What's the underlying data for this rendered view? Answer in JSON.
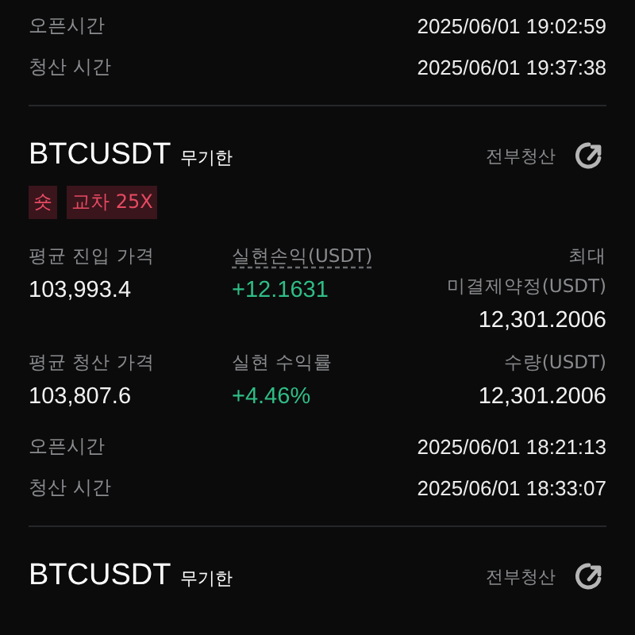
{
  "trades": [
    {
      "times": [
        {
          "label": "오픈시간",
          "value": "2025/06/01 19:02:59"
        },
        {
          "label": "청산 시간",
          "value": "2025/06/01 19:37:38"
        }
      ]
    },
    {
      "symbol": "BTCUSDT",
      "contract": "무기한",
      "action": "전부청산",
      "tags": [
        {
          "label": "숏"
        },
        {
          "label": "교차 25X"
        }
      ],
      "stats": [
        {
          "label": "평균 진입 가격",
          "value": "103,993.4",
          "kind": "plain"
        },
        {
          "label": "실현손익(USDT)",
          "value": "+12.1631",
          "kind": "profit",
          "underlined": true
        },
        {
          "label": "최대\n미결제약정(USDT)",
          "value": "12,301.2006",
          "kind": "plain"
        },
        {
          "label": "평균 청산 가격",
          "value": "103,807.6",
          "kind": "plain"
        },
        {
          "label": "실현 수익률",
          "value": "+4.46%",
          "kind": "profit",
          "underlined": false
        },
        {
          "label": "수량(USDT)",
          "value": "12,301.2006",
          "kind": "plain"
        }
      ],
      "times": [
        {
          "label": "오픈시간",
          "value": "2025/06/01 18:21:13"
        },
        {
          "label": "청산 시간",
          "value": "2025/06/01 18:33:07"
        }
      ]
    },
    {
      "symbol": "BTCUSDT",
      "contract": "무기한",
      "action": "전부청산"
    }
  ]
}
